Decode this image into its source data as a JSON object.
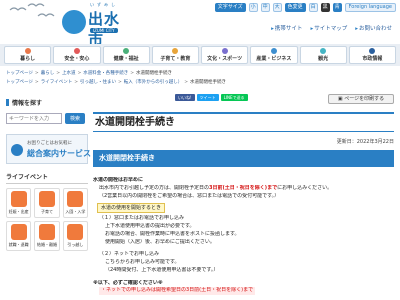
{
  "header": {
    "logo_title": "出水市",
    "logo_ruby": "いずみし",
    "logo_sub": "IZUMI CITY",
    "font_size_label": "文字サイズ",
    "font_sizes": [
      "小",
      "中",
      "大"
    ],
    "color_label": "色変更",
    "colors": [
      "白",
      "黒",
      "青"
    ],
    "foreign_language": "Foreign language",
    "links": [
      "携帯サイト",
      "サイトマップ",
      "お問い合わせ"
    ]
  },
  "nav": {
    "items": [
      {
        "label": "暮らし",
        "color": "#e9784a"
      },
      {
        "label": "安全・安心",
        "color": "#e25a5a"
      },
      {
        "label": "健康・福祉",
        "color": "#4ab07a"
      },
      {
        "label": "子育て・教育",
        "color": "#e8a53a"
      },
      {
        "label": "文化・スポーツ",
        "color": "#7a6fcf"
      },
      {
        "label": "産業・ビジネス",
        "color": "#3d8fd0"
      },
      {
        "label": "観光",
        "color": "#45b5c4"
      },
      {
        "label": "市政情報",
        "color": "#2a5f9e"
      }
    ]
  },
  "breadcrumbs": {
    "row1": [
      "トップページ",
      "暮らし",
      "上水道",
      "水道料金・各種手続き",
      "水道開閉栓手続き"
    ],
    "row2": [
      "トップページ",
      "ライフイベント",
      "引っ越し・住まい",
      "転入（市外からの引っ越し）",
      "水道開閉栓手続き"
    ]
  },
  "sidebar": {
    "search_heading": "情報を探す",
    "search_placeholder": "キーワードを入力",
    "search_button": "検索",
    "service_small": "お困りごとはお気軽に",
    "service_big": "総合案内サービス",
    "life_heading": "ライフイベント",
    "life_items": [
      "妊娠・出産",
      "子育て",
      "入園・入学",
      "就職・退職",
      "結婚・離婚",
      "引っ越し"
    ]
  },
  "share": {
    "buttons": [
      "いいね!",
      "ツイート",
      "LINEで送る"
    ],
    "print_label": "ページを印刷する"
  },
  "main": {
    "title": "水道開閉栓手続き",
    "updated": "更新日：2022年3月22日",
    "section_title": "水道開閉栓手続き",
    "p1_heading": "水道の開栓はお早めに",
    "p1_line1a": "出水市内でお引越し予定の方は、開閉栓予定日の",
    "p1_line1_red": "3日前(土日・祝日を除く)まで",
    "p1_line1b": "にお申し込みください。",
    "p1_line2": "（2営業日以内の開閉栓をご希望の場合は、窓口または電話での受付可能です。）",
    "hl_heading": "水道の使用を開始するとき",
    "items": [
      "（１）窓口またはお電話でお申し込み",
      "上下水道使用申込書の提出が必要です。",
      "お電話の場合、開栓作業時に申込書をポストに投函します。",
      "使用開始（入居）後、お早めにご提出ください。",
      "（２）ネットでお申し込み",
      "こちらからお申し込み可能です。",
      "（24時間受付、上下水道使用申込書は不要です。）"
    ],
    "caution_heading": "※以下、必ずご確認ください※",
    "caution_line": "・ネットでの申し込みは開栓希望日の3日前(土日・祝日を除く)まで"
  }
}
